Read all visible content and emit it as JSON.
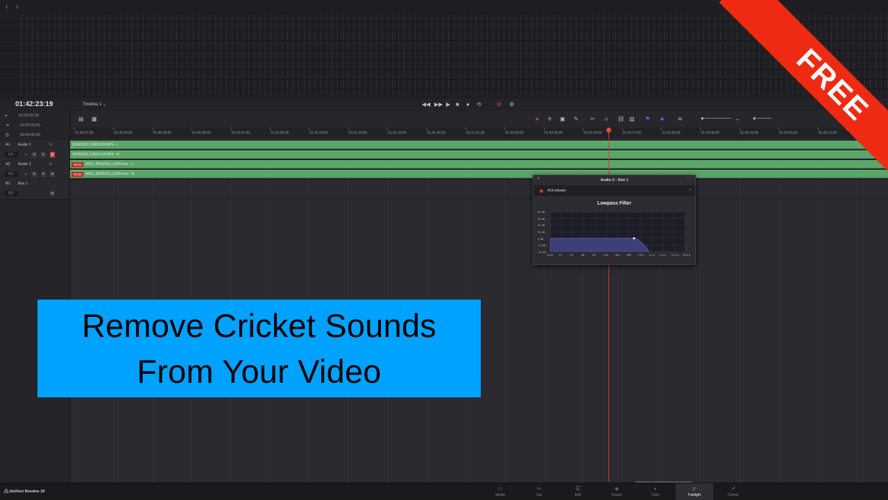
{
  "meter": {
    "channel_labels": [
      "1",
      "2"
    ]
  },
  "header": {
    "timecode": "01:42:23:19",
    "timeline_name": "Timeline 1"
  },
  "left_timecodes": [
    {
      "icon": "▸",
      "value": "01:00:00:00"
    },
    {
      "icon": "⇥",
      "value": "01:00:00:00"
    },
    {
      "icon": "◷",
      "value": "00:00:00:00"
    }
  ],
  "tracks": [
    {
      "id": "A1",
      "name": "Audio 1",
      "fx": "fx",
      "volume": "0.0",
      "mute_active": true
    },
    {
      "id": "A2",
      "name": "Audio 2",
      "fx": "fx",
      "volume": "0.0",
      "mute_active": false
    },
    {
      "id": "B1",
      "name": "Bus 1",
      "fx": "",
      "volume": "0.0",
      "mute_active": false
    }
  ],
  "track_buttons": {
    "record": "R",
    "solo": "S",
    "mute": "M"
  },
  "ruler_ticks": [
    "01:40:21:00",
    "01:40:30:00",
    "01:40:39:00",
    "01:40:48:00",
    "01:40:57:00",
    "01:41:06:00",
    "01:41:15:00",
    "01:41:24:00",
    "01:41:33:00",
    "01:41:42:00",
    "01:41:51:00",
    "01:42:00:00",
    "01:42:09:00",
    "01:42:18:00",
    "01:42:27:00",
    "01:42:36:00",
    "01:42:45:00",
    "01:42:54:00",
    "01:43:03:00",
    "01:43:12:00"
  ],
  "clips": [
    {
      "label": "20240910_FX000128.MP4 - L",
      "badge": ""
    },
    {
      "label": "20240910_FX000128.MP4 - R",
      "badge": ""
    },
    {
      "label": "A001_09102315_C003.mov - L",
      "badge": "-00:01"
    },
    {
      "label": "A001_09102315_C003.mov - R",
      "badge": "-00:01"
    }
  ],
  "plugin": {
    "title": "Audio 2 - Slot 1",
    "plugin_name": "AULowpass",
    "filter_title": "Lowpass Filter",
    "db_labels": [
      "40 dB",
      "30 dB",
      "20 dB",
      "10 dB",
      "0 dB",
      "-10 dB",
      "-20 dB"
    ],
    "hz_labels": [
      "6 Hz",
      "12",
      "24",
      "48",
      "96",
      "192",
      "384",
      "768",
      "1.5 k",
      "3.1 k",
      "6.1 k",
      "12.3 k",
      "24.6 k"
    ],
    "cutoff_fraction": 0.62
  },
  "overlay": {
    "line1": "Remove Cricket Sounds",
    "line2": "From Your Video",
    "color": "#00a2ff"
  },
  "ribbon": {
    "text": "FREE",
    "color": "#ee2a13"
  },
  "bottom": {
    "brand": "DaVinci Resolve 19",
    "pages": [
      {
        "label": "Media",
        "icon": "▭"
      },
      {
        "label": "Cut",
        "icon": "✂"
      },
      {
        "label": "Edit",
        "icon": "☰"
      },
      {
        "label": "Fusion",
        "icon": "◈"
      },
      {
        "label": "Color",
        "icon": "◐"
      },
      {
        "label": "Fairlight",
        "icon": "♬",
        "active": true
      },
      {
        "label": "Deliver",
        "icon": "➚"
      }
    ]
  }
}
